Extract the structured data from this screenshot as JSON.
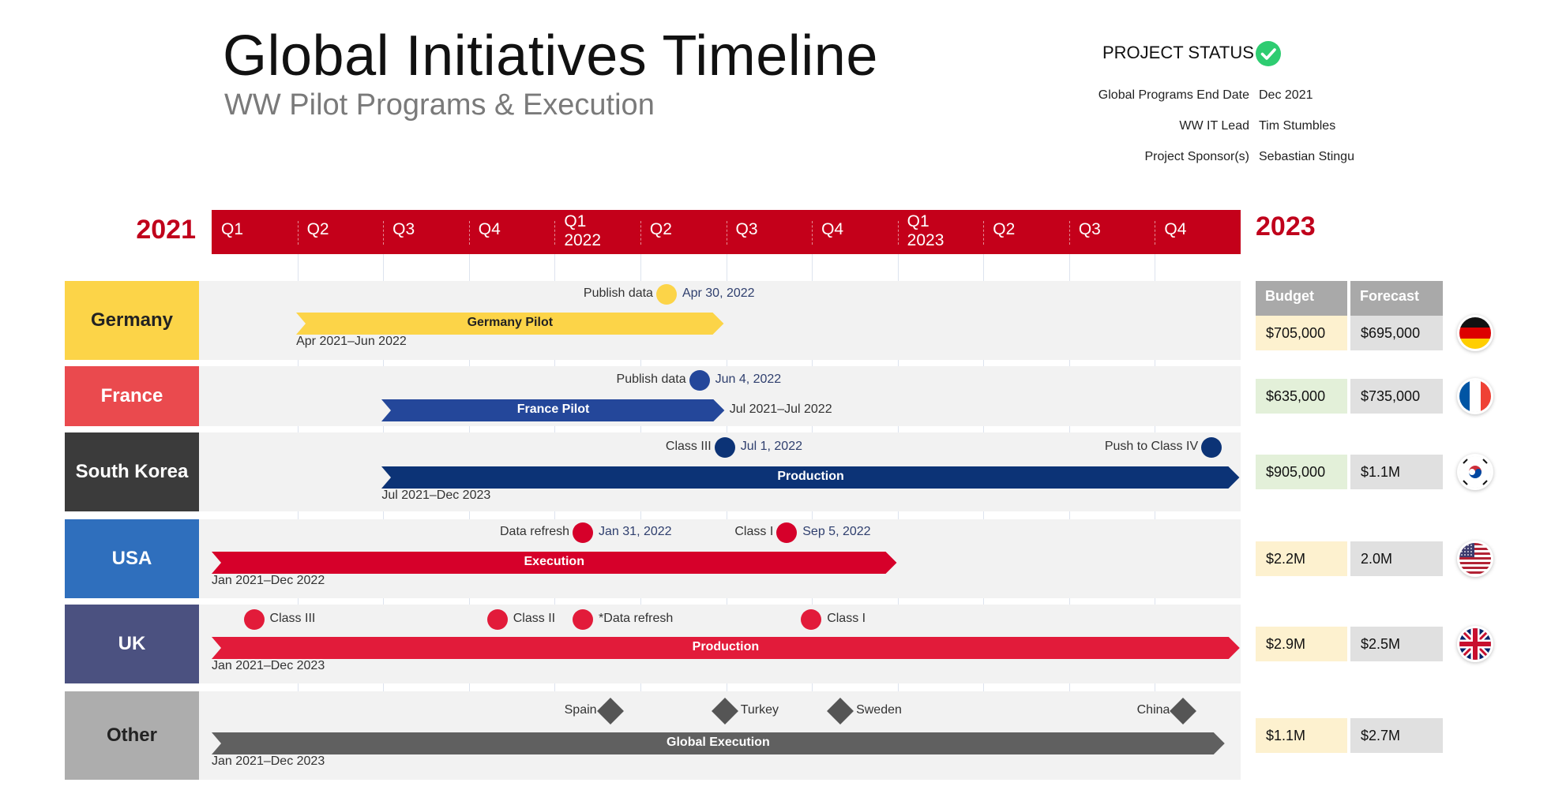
{
  "header": {
    "title": "Global Initiatives Timeline",
    "subtitle": "WW Pilot Programs & Execution"
  },
  "status": {
    "heading": "PROJECT STATUS",
    "check_color": "#2ecc71",
    "items": [
      {
        "label": "Global Programs End Date",
        "value": "Dec 2021"
      },
      {
        "label": "WW IT Lead",
        "value": "Tim Stumbles"
      },
      {
        "label": "Project Sponsor(s)",
        "value": "Sebastian Stingu"
      }
    ]
  },
  "chart_data": {
    "type": "gantt",
    "year_start_label": "2021",
    "year_end_label": "2023",
    "quarters": [
      "Q1",
      "Q2",
      "Q3",
      "Q4",
      "Q1\n2022",
      "Q2",
      "Q3",
      "Q4",
      "Q1\n2023",
      "Q2",
      "Q3",
      "Q4"
    ],
    "range": [
      "2021-01-01",
      "2024-01-01"
    ],
    "header_color": "#c4001a",
    "table_headers": {
      "budget": "Budget",
      "forecast": "Forecast"
    },
    "rows": [
      {
        "name": "Germany",
        "label_bg": "#fcd448",
        "label_color": "#222222",
        "bar": {
          "label": "Germany Pilot",
          "start": "2021-04-01",
          "end": "2022-06-30",
          "color": "#fcd448",
          "text_color": "#222222",
          "range_text": "Apr 2021–Jun 2022"
        },
        "milestones": [
          {
            "label": "Publish data",
            "date": "2022-04-30",
            "date_text": "Apr 30, 2022",
            "shape": "circle",
            "color": "#fcd448"
          }
        ],
        "budget": "$705,000",
        "forecast": "$695,000",
        "budget_bg": "#fdf1cf",
        "flag": "germany-flag"
      },
      {
        "name": "France",
        "label_bg": "#ea4a4e",
        "label_color": "#ffffff",
        "bar": {
          "label": "France Pilot",
          "start": "2021-07-01",
          "end": "2022-07-01",
          "color": "#24479a",
          "text_color": "#ffffff",
          "range_text": "Jul 2021–Jul 2022"
        },
        "milestones": [
          {
            "label": "Publish data",
            "date": "2022-06-04",
            "date_text": "Jun 4, 2022",
            "shape": "circle",
            "color": "#24479a"
          }
        ],
        "budget": "$635,000",
        "forecast": "$735,000",
        "budget_bg": "#e3f0d9",
        "flag": "france-flag"
      },
      {
        "name": "South Korea",
        "label_bg": "#3b3b3b",
        "label_color": "#ffffff",
        "bar": {
          "label": "Production",
          "start": "2021-07-01",
          "end": "2023-12-31",
          "color": "#0c3376",
          "text_color": "#ffffff",
          "range_text": "Jul 2021–Dec 2023"
        },
        "milestones": [
          {
            "label": "Class III",
            "date": "2022-07-01",
            "date_text": "Jul 1, 2022",
            "shape": "circle",
            "color": "#0c3376"
          },
          {
            "label": "Push to Class IV",
            "date": "2023-12-01",
            "date_text": "",
            "shape": "circle",
            "color": "#0c3376"
          }
        ],
        "budget": "$905,000",
        "forecast": "$1.1M",
        "budget_bg": "#e3f0d9",
        "flag": "south-korea-flag"
      },
      {
        "name": "USA",
        "label_bg": "#2f6fbd",
        "label_color": "#ffffff",
        "bar": {
          "label": "Execution",
          "start": "2021-01-01",
          "end": "2022-12-31",
          "color": "#d6002a",
          "text_color": "#ffffff",
          "range_text": "Jan 2021–Dec 2022"
        },
        "milestones": [
          {
            "label": "Data refresh",
            "date": "2022-01-31",
            "date_text": "Jan 31, 2022",
            "shape": "circle",
            "color": "#d6002a"
          },
          {
            "label": "Class I",
            "date": "2022-09-05",
            "date_text": "Sep 5, 2022",
            "shape": "circle",
            "color": "#d6002a"
          }
        ],
        "budget": "$2.2M",
        "forecast": "2.0M",
        "budget_bg": "#fdf1cf",
        "flag": "usa-flag"
      },
      {
        "name": "UK",
        "label_bg": "#4b5180",
        "label_color": "#ffffff",
        "bar": {
          "label": "Production",
          "start": "2021-01-01",
          "end": "2023-12-31",
          "color": "#e21b3a",
          "text_color": "#ffffff",
          "range_text": "Jan 2021–Dec 2023"
        },
        "milestones": [
          {
            "label": "Class III",
            "date": "2021-02-15",
            "date_text": "",
            "shape": "circle",
            "color": "#e21b3a"
          },
          {
            "label": "Class II",
            "date": "2021-11-01",
            "date_text": "",
            "shape": "circle",
            "color": "#e21b3a"
          },
          {
            "label": "*Data refresh",
            "date": "2022-01-31",
            "date_text": "",
            "shape": "circle",
            "color": "#e21b3a"
          },
          {
            "label": "Class I",
            "date": "2022-10-01",
            "date_text": "",
            "shape": "circle",
            "color": "#e21b3a"
          }
        ],
        "budget": "$2.9M",
        "forecast": "$2.5M",
        "budget_bg": "#fdf1cf",
        "flag": "uk-flag"
      },
      {
        "name": "Other",
        "label_bg": "#adadad",
        "label_color": "#222222",
        "bar": {
          "label": "Global Execution",
          "start": "2021-01-01",
          "end": "2023-12-15",
          "color": "#606060",
          "text_color": "#ffffff",
          "range_text": "Jan 2021–Dec 2023"
        },
        "milestones": [
          {
            "label": "Spain",
            "date": "2022-03-01",
            "date_text": "",
            "shape": "diamond",
            "color": "#555555"
          },
          {
            "label": "Turkey",
            "date": "2022-07-01",
            "date_text": "",
            "shape": "diamond",
            "color": "#555555"
          },
          {
            "label": "Sweden",
            "date": "2022-11-01",
            "date_text": "",
            "shape": "diamond",
            "color": "#555555"
          },
          {
            "label": "China",
            "date": "2023-11-01",
            "date_text": "",
            "shape": "diamond",
            "color": "#555555"
          }
        ],
        "budget": "$1.1M",
        "forecast": "$2.7M",
        "budget_bg": "#fdf1cf",
        "flag": "other-flag"
      }
    ]
  }
}
